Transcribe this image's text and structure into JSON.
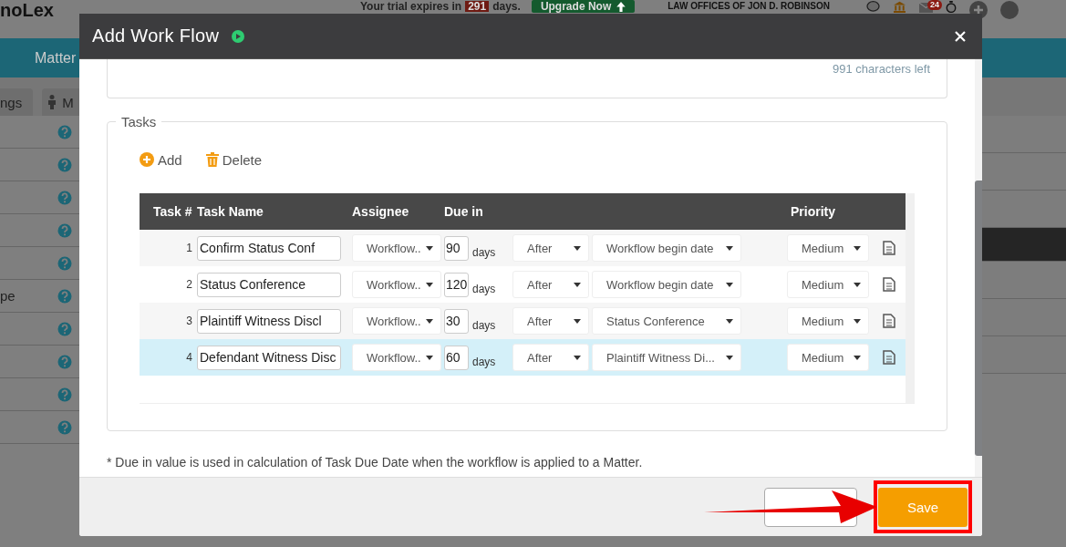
{
  "app": {
    "logo": "noLex",
    "trial": {
      "prefix": "Your trial expires in",
      "days": "291",
      "suffix": "days."
    },
    "upgrade": "Upgrade Now",
    "firm": "LAW OFFICES OF JON D. ROBINSON",
    "notifications": "24",
    "nav": "Matter",
    "tabs": [
      "ngs",
      "M"
    ],
    "rows": [
      "",
      "",
      "",
      "",
      "",
      "pe",
      "",
      "",
      "",
      ""
    ]
  },
  "dialog": {
    "title": "Add Work Flow",
    "chars_left": "991 characters left",
    "tasks_legend": "Tasks",
    "add": "Add",
    "delete": "Delete",
    "columns": [
      "Task #",
      "Task Name",
      "Assignee",
      "Due in",
      "Priority"
    ],
    "rows": [
      {
        "number": "1",
        "name": "Confirm Status Conf",
        "assignee": "Workflow..",
        "due": "90",
        "unit": "days",
        "relation": "After",
        "anchor": "Workflow begin date",
        "priority": "Medium",
        "selected": false
      },
      {
        "number": "2",
        "name": "Status Conference",
        "assignee": "Workflow..",
        "due": "120",
        "unit": "days",
        "relation": "After",
        "anchor": "Workflow begin date",
        "priority": "Medium",
        "selected": false
      },
      {
        "number": "3",
        "name": "Plaintiff Witness Discl",
        "assignee": "Workflow..",
        "due": "30",
        "unit": "days",
        "relation": "After",
        "anchor": "Status Conference",
        "priority": "Medium",
        "selected": false
      },
      {
        "number": "4",
        "name": "Defendant Witness Disc",
        "assignee": "Workflow..",
        "due": "60",
        "unit": "days",
        "relation": "After",
        "anchor": "Plaintiff Witness Di...",
        "priority": "Medium",
        "selected": true
      }
    ],
    "footnote": "* Due in value is used in calculation of Task Due Date when the workflow is applied to a Matter.",
    "save": "Save"
  }
}
